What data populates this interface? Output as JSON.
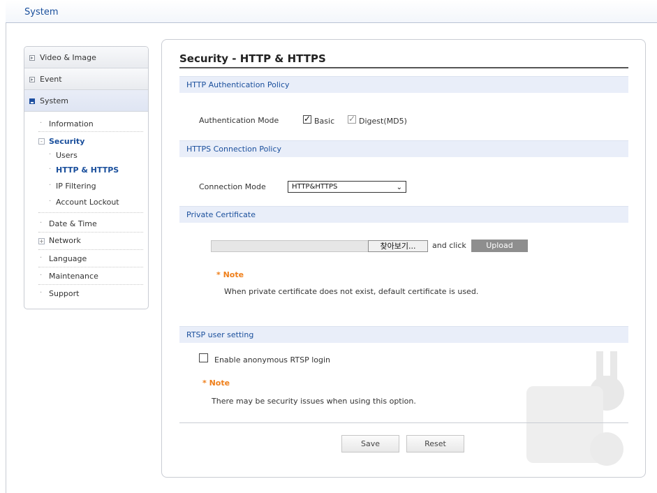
{
  "app": {
    "title": "System"
  },
  "sidebar": {
    "groups": [
      {
        "label": "Video & Image"
      },
      {
        "label": "Event"
      },
      {
        "label": "System"
      }
    ],
    "items": {
      "information": "Information",
      "security": "Security",
      "users": "Users",
      "http_https": "HTTP & HTTPS",
      "ip_filtering": "IP Filtering",
      "account_lockout": "Account Lockout",
      "date_time": "Date & Time",
      "network": "Network",
      "language": "Language",
      "maintenance": "Maintenance",
      "support": "Support"
    }
  },
  "main": {
    "title": "Security - HTTP & HTTPS",
    "http_auth": {
      "section": "HTTP Authentication Policy",
      "label": "Authentication Mode",
      "basic": "Basic",
      "basic_checked": true,
      "digest": "Digest(MD5)",
      "digest_checked": true
    },
    "https": {
      "section": "HTTPS Connection Policy",
      "label": "Connection Mode",
      "value": "HTTP&HTTPS"
    },
    "certificate": {
      "section": "Private Certificate",
      "browse_label": "찾아보기...",
      "and_click": "and click",
      "upload_label": "Upload",
      "note_title": "* Note",
      "note_text": "When private certificate does not exist, default certificate is used."
    },
    "rtsp": {
      "section": "RTSP user setting",
      "checkbox_label": "Enable anonymous RTSP login",
      "checked": false,
      "note_title": "* Note",
      "note_text": "There may be security issues when using this option."
    },
    "buttons": {
      "save": "Save",
      "reset": "Reset"
    }
  },
  "icons": {
    "group_bullet": "square-arrow-icon",
    "expand": "plus-box-icon",
    "dropdown": "chevron-down-icon",
    "decoration": "wrench-gear-icon"
  },
  "colors": {
    "accent": "#1a4f9c",
    "section_bg": "#e9eef9",
    "note": "#ef7f1a",
    "upload_bg": "#8e8e8e"
  }
}
